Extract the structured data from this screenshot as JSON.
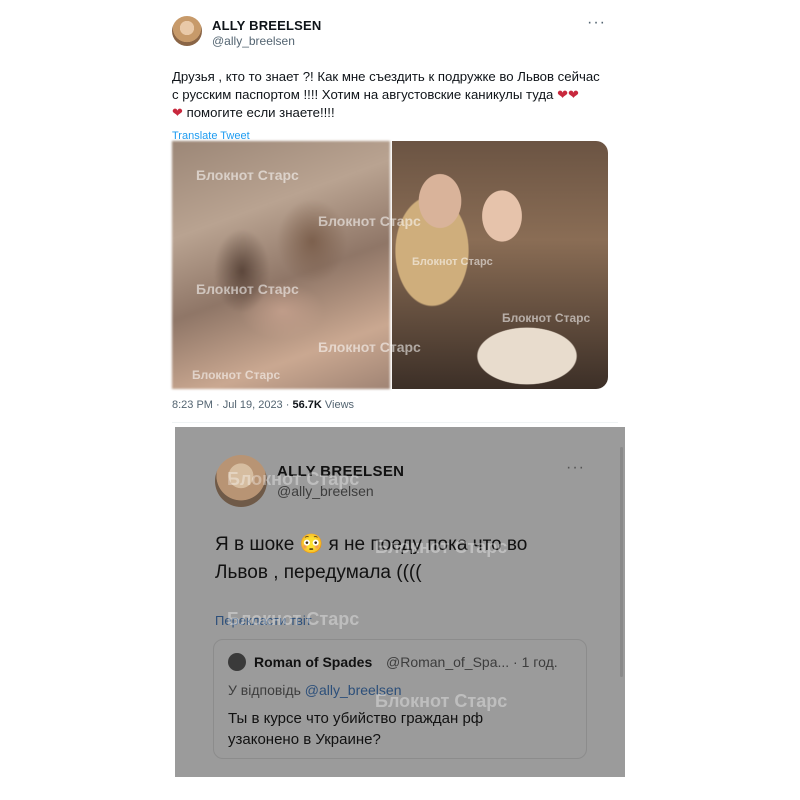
{
  "tweet1": {
    "name": "ALLY BREELSEN",
    "handle": "@ally_breelsen",
    "more": "···",
    "text_line1": "Друзья , кто то знает ?! Как мне съездить к подружке во Львов сейчас",
    "text_line2": "с русским паспортом !!!! Хотим на августовские каникулы туда",
    "text_line3": "помогите если знаете!!!!",
    "translate": "Translate Tweet",
    "meta_time": "8:23 PM · Jul 19, 2023 · ",
    "meta_views_count": "56.7K",
    "meta_views_label": " Views"
  },
  "watermark": "Блокнот Старс",
  "tweet2": {
    "name": "ALLY BREELSEN",
    "handle": "@ally_breelsen",
    "more": "···",
    "text_line1": "Я в шоке 😳 я не поеду пока что во",
    "text_line2": "Львов , передумала ((((",
    "translate": "Перекласти твіт",
    "quote": {
      "name": "Roman of Spades",
      "handle_time": "@Roman_of_Spa... · 1 год.",
      "reply_prefix": "У відповідь ",
      "reply_handle": "@ally_breelsen",
      "text_line1": "Ты в курсе что убийство граждан рф",
      "text_line2": "узаконено в Украине?"
    }
  }
}
